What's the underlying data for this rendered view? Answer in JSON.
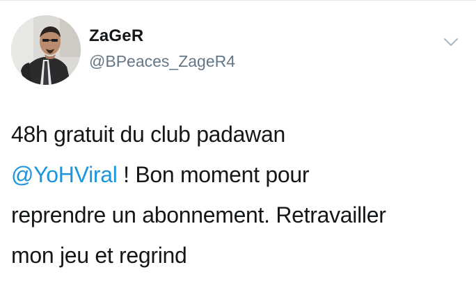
{
  "tweet": {
    "author": {
      "display_name": "ZaGeR",
      "handle": "@BPeaces_ZageR4"
    },
    "text": {
      "line1": "48h gratuit du club padawan",
      "mention": "@YoHViral",
      "line2_rest": " ! Bon moment pour",
      "line3": "reprendre un abonnement. Retravailler",
      "line4": "mon jeu et regrind"
    },
    "colors": {
      "mention": "#1b95e0",
      "handle": "#657786",
      "text": "#14171a"
    },
    "icons": {
      "menu": "chevron-down-icon"
    }
  }
}
